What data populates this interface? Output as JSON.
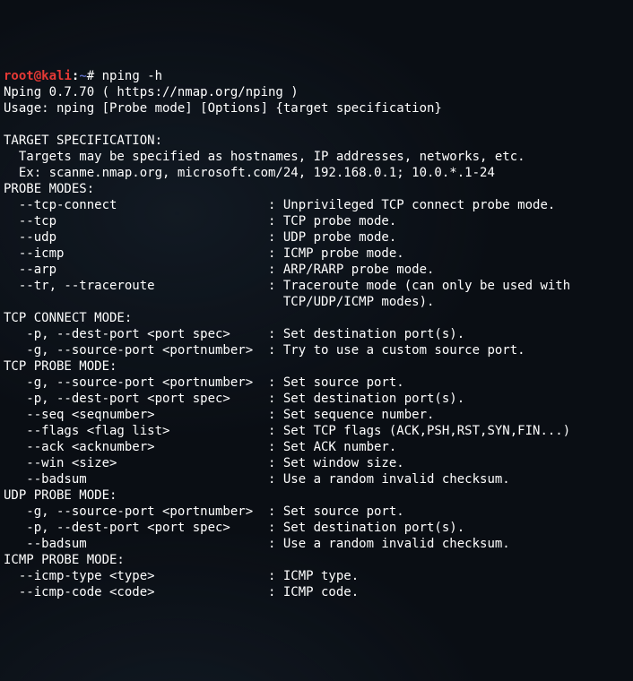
{
  "prompt": {
    "user": "root",
    "at": "@",
    "host": "kali",
    "colon": ":",
    "path": "~",
    "hash": "#",
    "command": " nping -h"
  },
  "lines": [
    "Nping 0.7.70 ( https://nmap.org/nping )",
    "Usage: nping [Probe mode] [Options] {target specification}",
    "",
    "TARGET SPECIFICATION:",
    "  Targets may be specified as hostnames, IP addresses, networks, etc.",
    "  Ex: scanme.nmap.org, microsoft.com/24, 192.168.0.1; 10.0.*.1-24",
    "PROBE MODES:",
    "  --tcp-connect                    : Unprivileged TCP connect probe mode.",
    "  --tcp                            : TCP probe mode.",
    "  --udp                            : UDP probe mode.",
    "  --icmp                           : ICMP probe mode.",
    "  --arp                            : ARP/RARP probe mode.",
    "  --tr, --traceroute               : Traceroute mode (can only be used with ",
    "                                     TCP/UDP/ICMP modes).",
    "TCP CONNECT MODE:",
    "   -p, --dest-port <port spec>     : Set destination port(s).",
    "   -g, --source-port <portnumber>  : Try to use a custom source port.",
    "TCP PROBE MODE:",
    "   -g, --source-port <portnumber>  : Set source port.",
    "   -p, --dest-port <port spec>     : Set destination port(s).",
    "   --seq <seqnumber>               : Set sequence number.",
    "   --flags <flag list>             : Set TCP flags (ACK,PSH,RST,SYN,FIN...)",
    "   --ack <acknumber>               : Set ACK number.",
    "   --win <size>                    : Set window size.",
    "   --badsum                        : Use a random invalid checksum.",
    "UDP PROBE MODE:",
    "   -g, --source-port <portnumber>  : Set source port.",
    "   -p, --dest-port <port spec>     : Set destination port(s).",
    "   --badsum                        : Use a random invalid checksum.",
    "ICMP PROBE MODE:",
    "  --icmp-type <type>               : ICMP type.",
    "  --icmp-code <code>               : ICMP code."
  ]
}
